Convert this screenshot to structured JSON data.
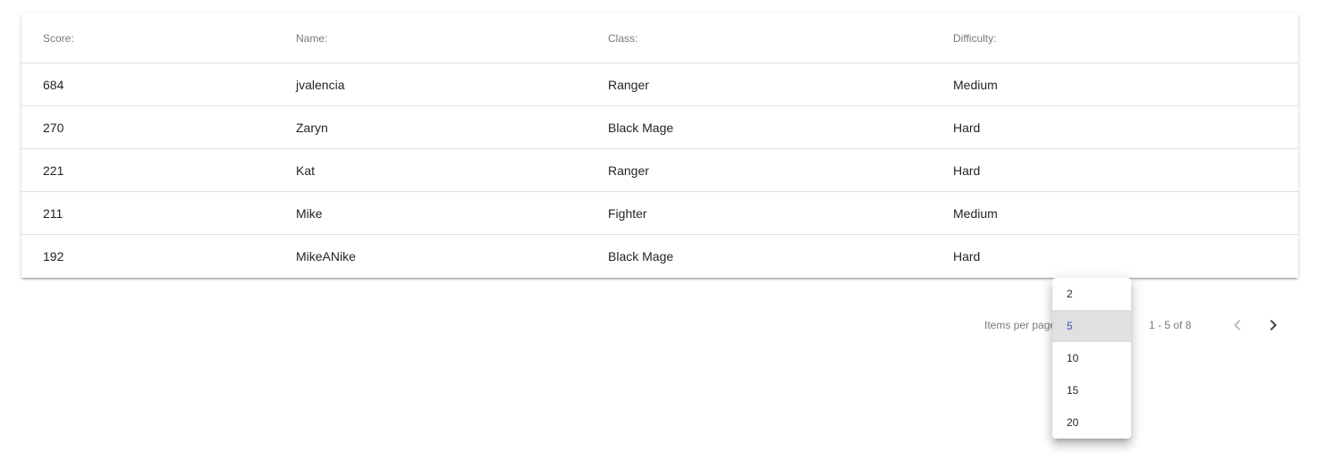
{
  "table": {
    "headers": [
      "Score:",
      "Name:",
      "Class:",
      "Difficulty:"
    ],
    "rows": [
      [
        "684",
        "jvalencia",
        "Ranger",
        "Medium"
      ],
      [
        "270",
        "Zaryn",
        "Black Mage",
        "Hard"
      ],
      [
        "221",
        "Kat",
        "Ranger",
        "Hard"
      ],
      [
        "211",
        "Mike",
        "Fighter",
        "Medium"
      ],
      [
        "192",
        "MikeANike",
        "Black Mage",
        "Hard"
      ]
    ]
  },
  "paginator": {
    "items_per_page_label": "Items per page:",
    "range_label": "1 - 5 of 8",
    "page_size_options": [
      "2",
      "5",
      "10",
      "15",
      "20"
    ],
    "selected_page_size": "5",
    "prev_icon": "chevron-left-icon",
    "next_icon": "chevron-right-icon"
  },
  "colors": {
    "accent": "#3f51b5",
    "selected_option_bg": "#e0e0e0",
    "disabled_icon": "#bdbdbd",
    "active_icon": "#616161"
  }
}
